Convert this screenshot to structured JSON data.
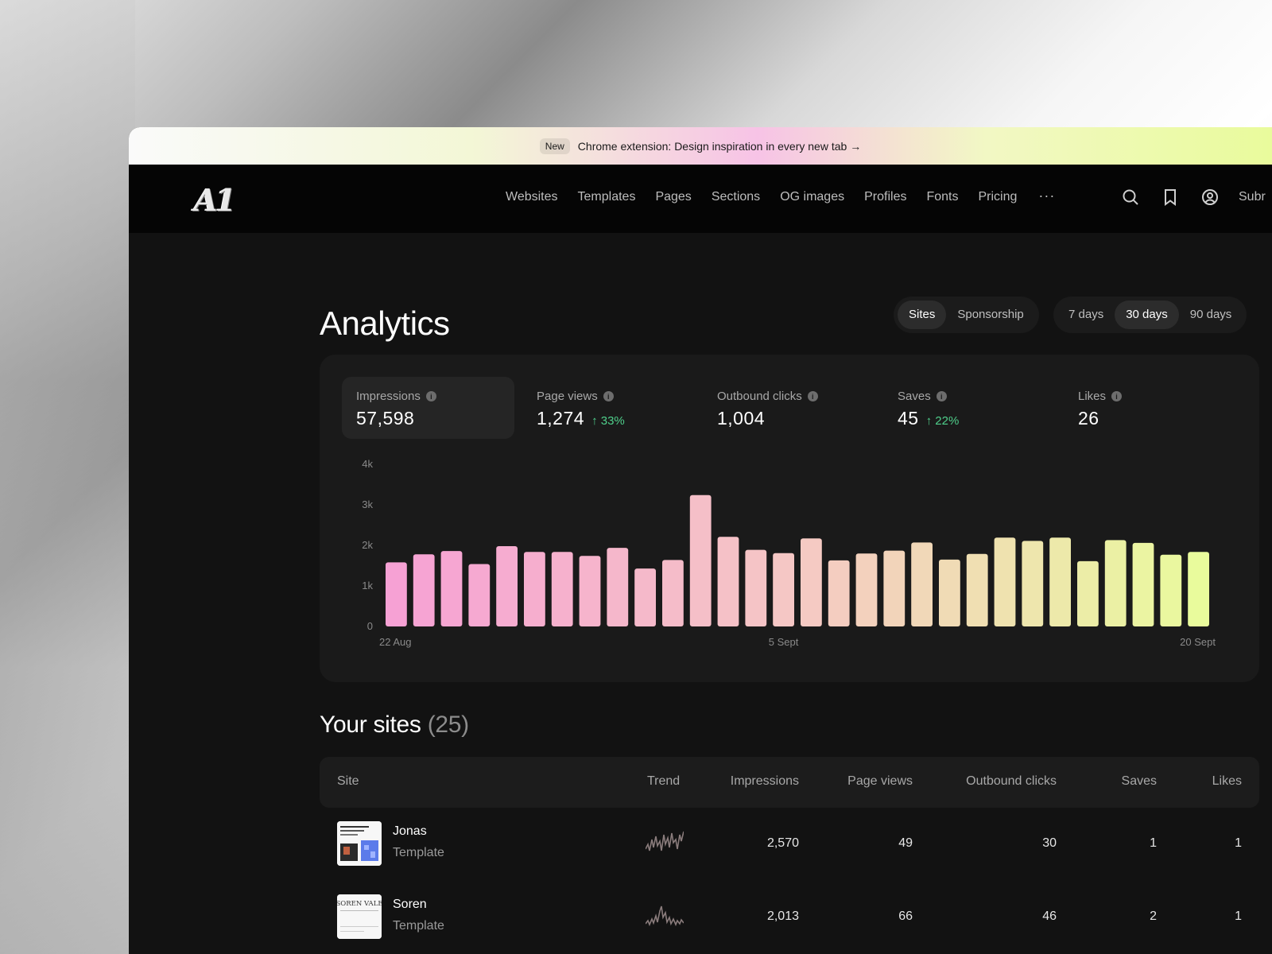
{
  "banner": {
    "badge": "New",
    "text": "Chrome extension: Design inspiration in every new tab →"
  },
  "nav": {
    "logo": "A1",
    "links": [
      "Websites",
      "Templates",
      "Pages",
      "Sections",
      "OG images",
      "Profiles",
      "Fonts",
      "Pricing"
    ],
    "more": "···",
    "icons": [
      "search-icon",
      "bookmark-icon",
      "user-icon"
    ],
    "submit": "Subr"
  },
  "page": {
    "title": "Analytics"
  },
  "filters": {
    "scope": [
      {
        "label": "Sites",
        "active": true
      },
      {
        "label": "Sponsorship",
        "active": false
      }
    ],
    "range": [
      {
        "label": "7 days",
        "active": false
      },
      {
        "label": "30 days",
        "active": true
      },
      {
        "label": "90 days",
        "active": false
      }
    ]
  },
  "stats": [
    {
      "label": "Impressions",
      "value": "57,598",
      "delta": "",
      "active": true
    },
    {
      "label": "Page views",
      "value": "1,274",
      "delta": "↑ 33%",
      "active": false
    },
    {
      "label": "Outbound clicks",
      "value": "1,004",
      "delta": "",
      "active": false
    },
    {
      "label": "Saves",
      "value": "45",
      "delta": "↑ 22%",
      "active": false
    },
    {
      "label": "Likes",
      "value": "26",
      "delta": "",
      "active": false
    }
  ],
  "chart_data": {
    "type": "bar",
    "ylim": [
      0,
      4000
    ],
    "yticks": [
      "0",
      "1k",
      "2k",
      "3k",
      "4k"
    ],
    "xlabels": [
      "22 Aug",
      "5 Sept",
      "20 Sept"
    ],
    "values": [
      1580,
      1780,
      1860,
      1540,
      1980,
      1840,
      1840,
      1740,
      1940,
      1430,
      1640,
      3240,
      2210,
      1890,
      1810,
      2170,
      1630,
      1800,
      1870,
      2070,
      1650,
      1790,
      2190,
      2110,
      2190,
      1610,
      2130,
      2060,
      1770,
      1840
    ],
    "colors": {
      "start": "#f6a1d4",
      "mid": "#f5c8c4",
      "end": "#e9fb9c"
    }
  },
  "sites": {
    "title": "Your sites",
    "count": "(25)",
    "columns": {
      "site": "Site",
      "trend": "Trend",
      "impressions": "Impressions",
      "page_views": "Page views",
      "outbound_clicks": "Outbound clicks",
      "saves": "Saves",
      "likes": "Likes"
    },
    "rows": [
      {
        "name": "Jonas",
        "type": "Template",
        "impressions": "2,570",
        "page_views": "49",
        "outbound_clicks": "30",
        "saves": "1",
        "likes": "1"
      },
      {
        "name": "Soren",
        "type": "Template",
        "thumb_text": "SOREN VALE",
        "impressions": "2,013",
        "page_views": "66",
        "outbound_clicks": "46",
        "saves": "2",
        "likes": "1"
      }
    ]
  }
}
